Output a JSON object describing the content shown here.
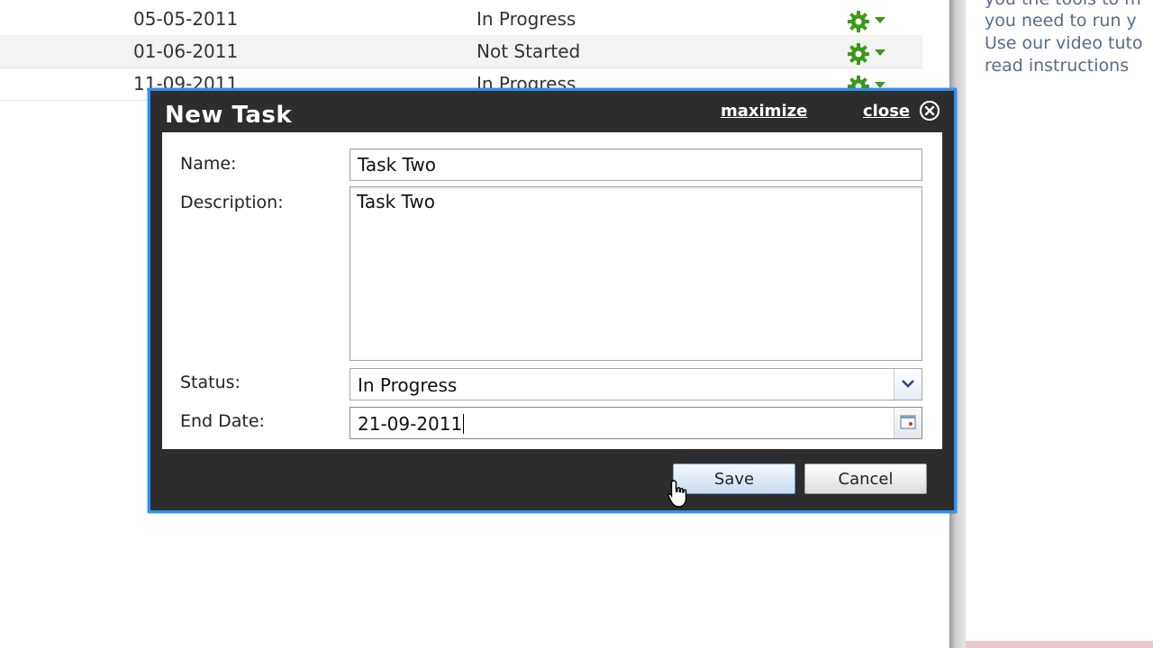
{
  "background_rows": [
    {
      "date": "05-05-2011",
      "status": "In Progress"
    },
    {
      "date": "01-06-2011",
      "status": "Not Started"
    },
    {
      "date": "11-09-2011",
      "status": "In Progress"
    }
  ],
  "side_panel": {
    "lines": [
      "you the tools to m",
      "you need to run y",
      "Use our video tuto",
      "read instructions"
    ]
  },
  "dialog": {
    "title": "New Task",
    "maximize_label": "maximize",
    "close_label": "close",
    "name_label": "Name:",
    "name_value": "Task Two",
    "description_label": "Description:",
    "description_value": "Task Two",
    "status_label": "Status:",
    "status_value": "In Progress",
    "end_date_label": "End Date:",
    "end_date_value": "21-09-2011",
    "save_label": "Save",
    "cancel_label": "Cancel"
  },
  "colors": {
    "dialog_border": "#2e8ff0",
    "dialog_bg": "#2d2d2d",
    "action_green": "#3a9a18"
  },
  "icons": [
    "gear-icon",
    "dropdown-caret-icon",
    "close-circle-icon",
    "chevron-down-icon",
    "calendar-icon",
    "hand-cursor-icon"
  ]
}
